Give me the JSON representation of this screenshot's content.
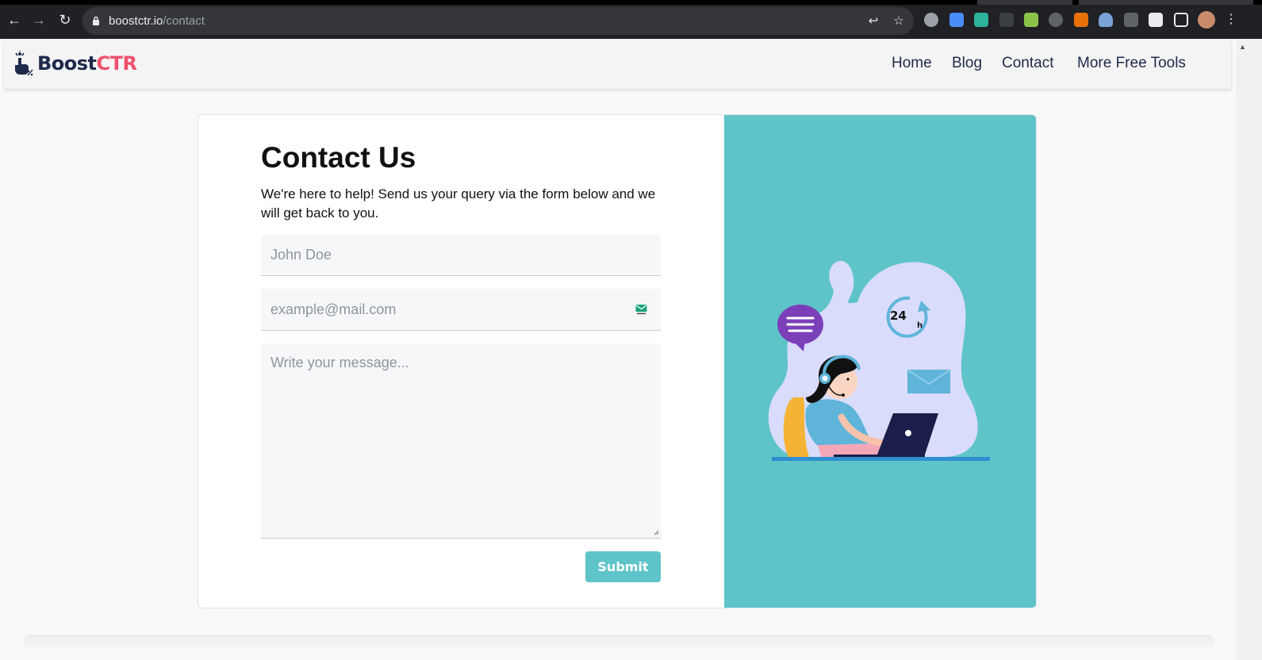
{
  "browser": {
    "url_host": "boostctr.io",
    "url_path": "/contact"
  },
  "site": {
    "logo_part1": "Boost",
    "logo_part2": "CTR",
    "brand_color": "#f0506e",
    "nav": [
      "Home",
      "Blog",
      "Contact",
      "More Free Tools"
    ]
  },
  "contact": {
    "title": "Contact Us",
    "description": "We're here to help! Send us your query via the form below and we will get back to you.",
    "name_placeholder": "John Doe",
    "email_placeholder": "example@mail.com",
    "message_placeholder": "Write your message...",
    "submit_label": "Submit",
    "accent_color": "#5fc4c9"
  },
  "illustration": {
    "clock_number": "24",
    "clock_unit": "h"
  },
  "icons": [
    "back-icon",
    "forward-icon",
    "reload-icon",
    "lock-icon",
    "share-icon",
    "star-icon",
    "extensions-icon",
    "sidepanel-icon",
    "profile-avatar",
    "menu-icon",
    "email-validation-icon"
  ]
}
